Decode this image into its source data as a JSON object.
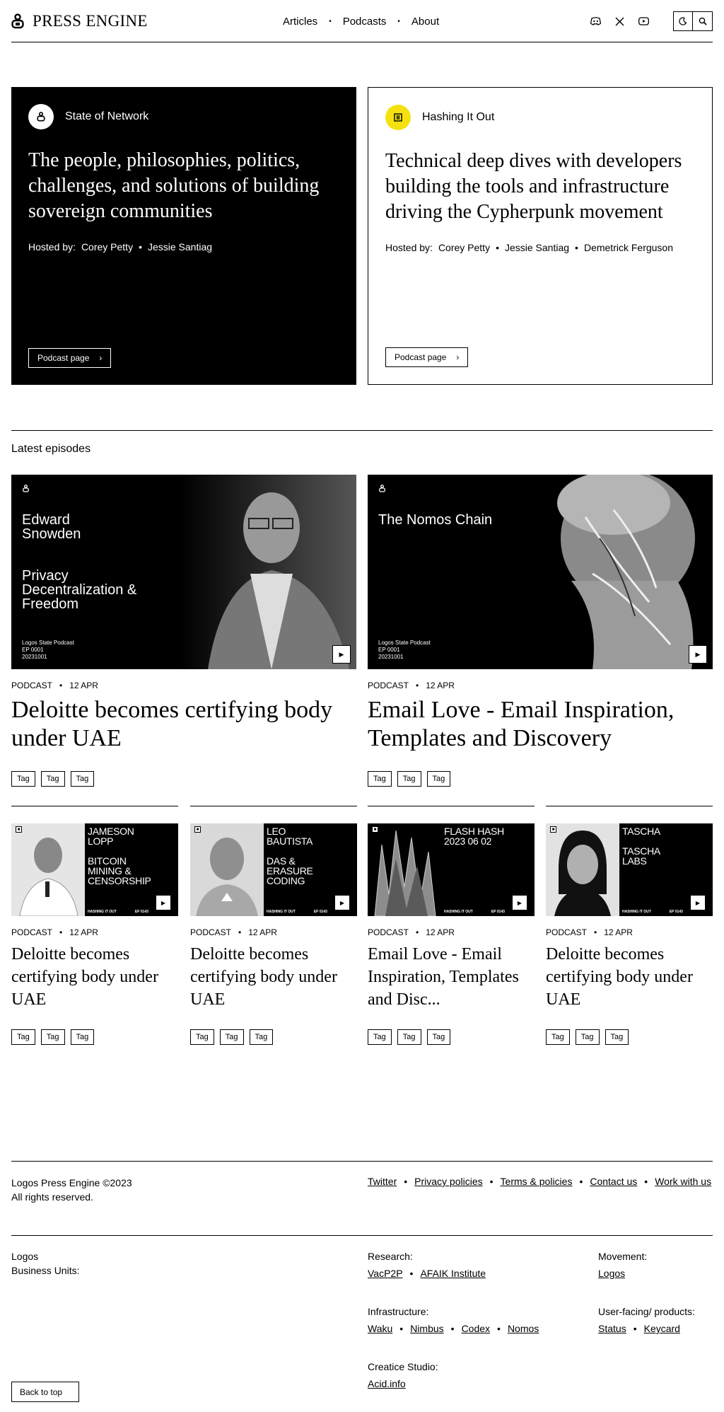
{
  "header": {
    "logo_text": "PRESS ENGINE",
    "nav": [
      "Articles",
      "Podcasts",
      "About"
    ],
    "social_icons": [
      "discord-icon",
      "x-icon",
      "youtube-icon"
    ],
    "theme_icon": "moon-icon",
    "search_icon": "search-icon"
  },
  "podcasts": [
    {
      "name": "State of Network",
      "description": "The people, philosophies, politics, challenges, and solutions of building sovereign communities",
      "hosted_label": "Hosted by:",
      "hosts": [
        "Corey Petty",
        "Jessie Santiag"
      ],
      "button": "Podcast page"
    },
    {
      "name": "Hashing It Out",
      "description": "Technical deep dives with developers building the tools and infrastructure driving the Cypherpunk movement",
      "hosted_label": "Hosted by:",
      "hosts": [
        "Corey Petty",
        "Jessie Santiag",
        "Demetrick Ferguson"
      ],
      "button": "Podcast page"
    }
  ],
  "latest": {
    "title": "Latest episodes",
    "featured": [
      {
        "thumb_title": "Edward\nSnowden",
        "thumb_sub": "Privacy\nDecentralization &\nFreedom",
        "thumb_meta": "Logos State Podcast\nEP 0001\n20231001",
        "type": "PODCAST",
        "date": "12 APR",
        "title": "Deloitte becomes certifying body under UAE",
        "tags": [
          "Tag",
          "Tag",
          "Tag"
        ]
      },
      {
        "thumb_title": "The Nomos Chain",
        "thumb_sub": "",
        "thumb_meta": "Logos State Podcast\nEP 0001\n20231001",
        "type": "PODCAST",
        "date": "12 APR",
        "title": "Email Love - Email Inspiration, Templates and Discovery",
        "tags": [
          "Tag",
          "Tag",
          "Tag"
        ]
      }
    ],
    "episodes": [
      {
        "thumb_text": "JAMESON\nLOPP\n\nBITCOIN\nMINING &\nCENSORSHIP",
        "thumb_show": "HASHING IT OUT",
        "thumb_ep": "EP 0143",
        "type": "PODCAST",
        "date": "12 APR",
        "title": "Deloitte becomes certifying body under UAE",
        "tags": [
          "Tag",
          "Tag",
          "Tag"
        ]
      },
      {
        "thumb_text": "LEO\nBAUTISTA\n\nDAS &\nERASURE\nCODING",
        "thumb_show": "HASHING IT OUT",
        "thumb_ep": "EP 0143",
        "type": "PODCAST",
        "date": "12 APR",
        "title": "Deloitte becomes certifying body under UAE",
        "tags": [
          "Tag",
          "Tag",
          "Tag"
        ]
      },
      {
        "thumb_text": "FLASH HASH\n2023 06 02",
        "thumb_show": "HASHING IT OUT",
        "thumb_ep": "EP 0143",
        "type": "PODCAST",
        "date": "12 APR",
        "title": "Email Love - Email Inspiration, Templates and Disc...",
        "tags": [
          "Tag",
          "Tag",
          "Tag"
        ]
      },
      {
        "thumb_text": "TASCHA\n\nTASCHA\nLABS",
        "thumb_show": "HASHING IT OUT",
        "thumb_ep": "EP 0143",
        "type": "PODCAST",
        "date": "12 APR",
        "title": "Deloitte becomes certifying body under UAE",
        "tags": [
          "Tag",
          "Tag",
          "Tag"
        ]
      }
    ]
  },
  "footer": {
    "copyright": "Logos Press Engine ©2023",
    "rights": "All rights reserved.",
    "links": [
      "Twitter",
      "Privacy policies",
      "Terms & policies",
      "Contact us",
      "Work with us"
    ],
    "bu_title": "Logos",
    "bu_subtitle": "Business Units:",
    "groups": {
      "research": {
        "label": "Research:",
        "links": [
          "VacP2P",
          "AFAIK Institute"
        ]
      },
      "movement": {
        "label": "Movement:",
        "links": [
          "Logos"
        ]
      },
      "infrastructure": {
        "label": "Infrastructure:",
        "links": [
          "Waku",
          "Nimbus",
          "Codex",
          "Nomos"
        ]
      },
      "user_facing": {
        "label": "User-facing/ products:",
        "links": [
          "Status",
          "Keycard"
        ]
      },
      "creative": {
        "label": "Creatice Studio:",
        "links": [
          "Acid.info"
        ]
      }
    },
    "back_to_top": "Back to top"
  }
}
